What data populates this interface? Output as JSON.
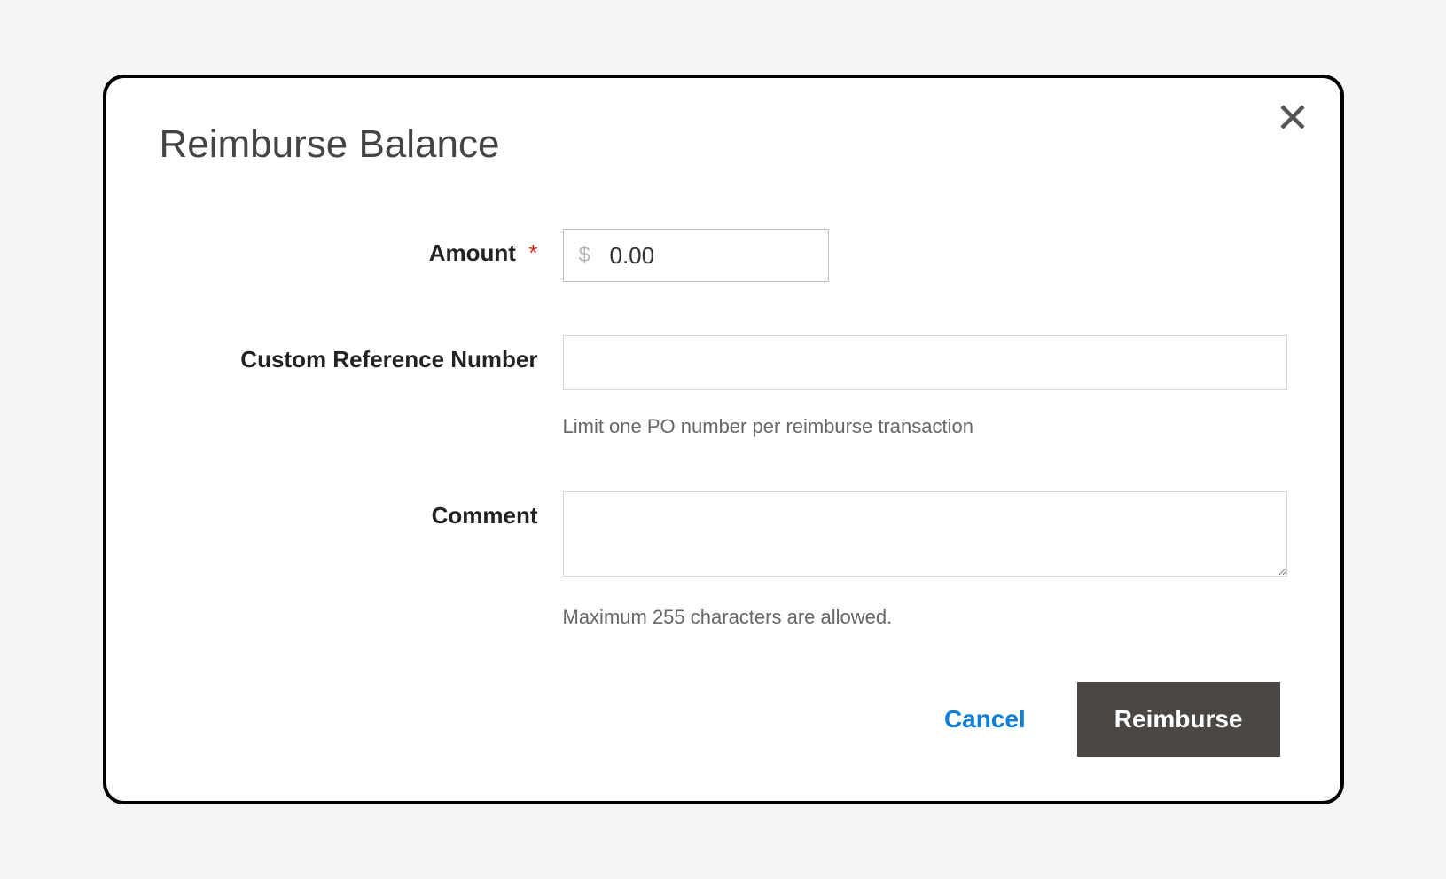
{
  "modal": {
    "title": "Reimburse Balance",
    "fields": {
      "amount": {
        "label": "Amount",
        "required_mark": "*",
        "currency_symbol": "$",
        "value": "0.00"
      },
      "reference": {
        "label": "Custom Reference Number",
        "value": "",
        "help": "Limit one PO number per reimburse transaction"
      },
      "comment": {
        "label": "Comment",
        "value": "",
        "help": "Maximum 255 characters are allowed."
      }
    },
    "actions": {
      "cancel": "Cancel",
      "submit": "Reimburse"
    }
  }
}
